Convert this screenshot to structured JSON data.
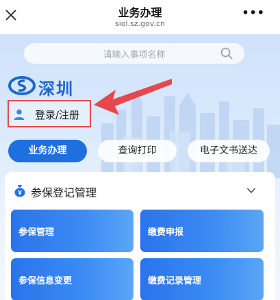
{
  "header": {
    "title": "业务办理",
    "url": "siol.sz.gov.cn",
    "close_icon": "close-icon",
    "more_label": "•••"
  },
  "search": {
    "placeholder": "请输入事项名称"
  },
  "brand": {
    "logo_text": "深圳",
    "logo_icon": "si-logo-icon"
  },
  "login": {
    "label": "登录/注册",
    "icon": "user-icon"
  },
  "tabs": [
    {
      "label": "业务办理",
      "active": true
    },
    {
      "label": "查询打印",
      "active": false
    },
    {
      "label": "电子文书送达",
      "active": false
    }
  ],
  "section": {
    "title": "参保登记管理",
    "icon": "money-bag-icon",
    "items": [
      {
        "label": "参保管理"
      },
      {
        "label": "缴费申报"
      },
      {
        "label": "参保信息变更"
      },
      {
        "label": "缴费记录管理"
      }
    ]
  },
  "colors": {
    "accent": "#1e6fe0",
    "highlight_border": "#e5484d"
  }
}
